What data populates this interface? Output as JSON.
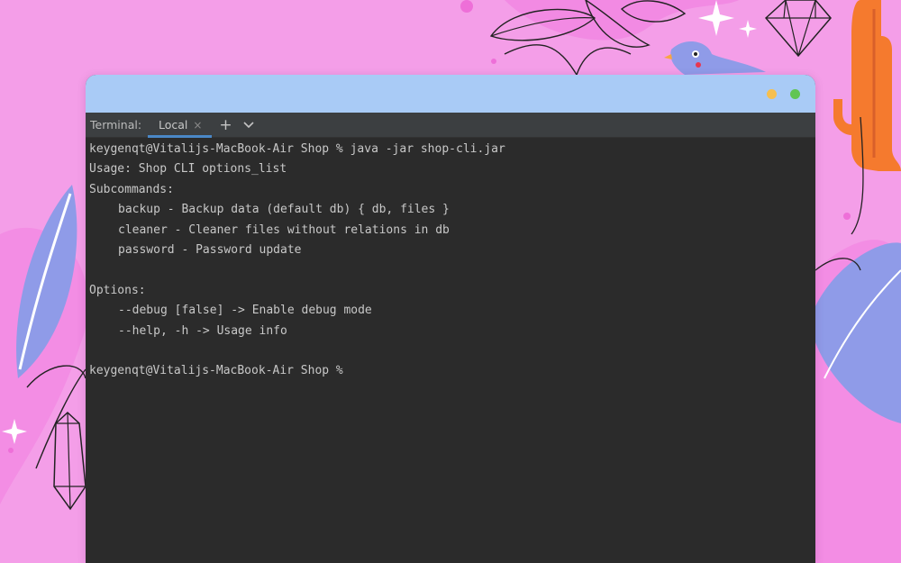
{
  "colors": {
    "background": "#f49ee8",
    "titlebar": "#a9cbf6",
    "traffic_minimize": "#f6bf4f",
    "traffic_maximize": "#61c554",
    "terminal_bg": "#2b2b2b",
    "tab_bar_bg": "#3c3f41",
    "tab_underline": "#4a88c7",
    "text": "#c8c8c8"
  },
  "icons": {
    "tab_close": "close-icon",
    "new_tab": "plus-icon",
    "tab_menu": "chevron-down-icon",
    "minimize": "yellow-traffic-light",
    "maximize": "green-traffic-light"
  },
  "terminal": {
    "panel_title": "Terminal:",
    "tab_label": "Local",
    "close_glyph": "×",
    "add_glyph": "+",
    "lines": {
      "l0": "keygenqt@Vitalijs-MacBook-Air Shop % java -jar shop-cli.jar",
      "l1": "Usage: Shop CLI options_list",
      "l2": "Subcommands:",
      "l3": "backup - Backup data (default db) { db, files }",
      "l4": "cleaner - Cleaner files without relations in db",
      "l5": "password - Password update",
      "l6": "",
      "l7": "Options:",
      "l8": "--debug [false] -> Enable debug mode",
      "l9": "--help, -h -> Usage info",
      "l10": "",
      "l11": "keygenqt@Vitalijs-MacBook-Air Shop %"
    }
  }
}
